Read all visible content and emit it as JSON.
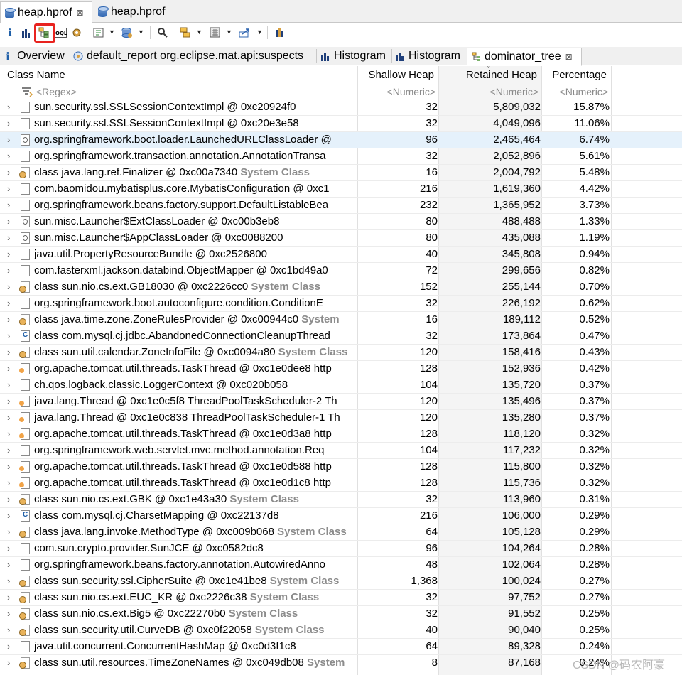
{
  "editor_tabs": [
    {
      "label": "heap.hprof",
      "close": "⊠"
    },
    {
      "label": "heap.hprof"
    }
  ],
  "toolbar": {
    "info": "i"
  },
  "result_tabs": [
    {
      "label": "Overview"
    },
    {
      "label": "default_report  org.eclipse.mat.api:suspects"
    },
    {
      "label": "Histogram"
    },
    {
      "label": "Histogram"
    },
    {
      "label": "dominator_tree",
      "close": "⊠"
    }
  ],
  "columns": {
    "class_name": "Class Name",
    "shallow": "Shallow Heap",
    "retained": "Retained Heap",
    "percentage": "Percentage"
  },
  "filters": {
    "class_name": "<Regex>",
    "shallow": "<Numeric>",
    "retained": "<Numeric>",
    "percentage": "<Numeric>"
  },
  "rows": [
    {
      "name": "sun.security.ssl.SSLSessionContextImpl @ 0xc20924f0",
      "sys": "",
      "shallow": "32",
      "retained": "5,809,032",
      "pct": "15.87%",
      "icon": "obj"
    },
    {
      "name": "sun.security.ssl.SSLSessionContextImpl @ 0xc20e3e58",
      "sys": "",
      "shallow": "32",
      "retained": "4,049,096",
      "pct": "11.06%",
      "icon": "obj"
    },
    {
      "name": "org.springframework.boot.loader.LaunchedURLClassLoader @",
      "sys": "",
      "shallow": "96",
      "retained": "2,465,464",
      "pct": "6.74%",
      "icon": "loader"
    },
    {
      "name": "org.springframework.transaction.annotation.AnnotationTransa",
      "sys": "",
      "shallow": "32",
      "retained": "2,052,896",
      "pct": "5.61%",
      "icon": "obj"
    },
    {
      "name": "class java.lang.ref.Finalizer @ 0xc00a7340 ",
      "sys": "System Class",
      "shallow": "16",
      "retained": "2,004,792",
      "pct": "5.48%",
      "icon": "cls"
    },
    {
      "name": "com.baomidou.mybatisplus.core.MybatisConfiguration @ 0xc1",
      "sys": "",
      "shallow": "216",
      "retained": "1,619,360",
      "pct": "4.42%",
      "icon": "obj"
    },
    {
      "name": "org.springframework.beans.factory.support.DefaultListableBea",
      "sys": "",
      "shallow": "232",
      "retained": "1,365,952",
      "pct": "3.73%",
      "icon": "obj"
    },
    {
      "name": "sun.misc.Launcher$ExtClassLoader @ 0xc00b3eb8",
      "sys": "",
      "shallow": "80",
      "retained": "488,488",
      "pct": "1.33%",
      "icon": "loader"
    },
    {
      "name": "sun.misc.Launcher$AppClassLoader @ 0xc0088200",
      "sys": "",
      "shallow": "80",
      "retained": "435,088",
      "pct": "1.19%",
      "icon": "loader"
    },
    {
      "name": "java.util.PropertyResourceBundle @ 0xc2526800",
      "sys": "",
      "shallow": "40",
      "retained": "345,808",
      "pct": "0.94%",
      "icon": "obj"
    },
    {
      "name": "com.fasterxml.jackson.databind.ObjectMapper @ 0xc1bd49a0",
      "sys": "",
      "shallow": "72",
      "retained": "299,656",
      "pct": "0.82%",
      "icon": "obj"
    },
    {
      "name": "class sun.nio.cs.ext.GB18030 @ 0xc2226cc0 ",
      "sys": "System Class",
      "shallow": "152",
      "retained": "255,144",
      "pct": "0.70%",
      "icon": "cls"
    },
    {
      "name": "org.springframework.boot.autoconfigure.condition.ConditionE",
      "sys": "",
      "shallow": "32",
      "retained": "226,192",
      "pct": "0.62%",
      "icon": "obj"
    },
    {
      "name": "class java.time.zone.ZoneRulesProvider @ 0xc00944c0 ",
      "sys": "System",
      "shallow": "16",
      "retained": "189,112",
      "pct": "0.52%",
      "icon": "cls"
    },
    {
      "name": "class com.mysql.cj.jdbc.AbandonedConnectionCleanupThread",
      "sys": "",
      "shallow": "32",
      "retained": "173,864",
      "pct": "0.47%",
      "icon": "cobj"
    },
    {
      "name": "class sun.util.calendar.ZoneInfoFile @ 0xc0094a80 ",
      "sys": "System Class",
      "shallow": "120",
      "retained": "158,416",
      "pct": "0.43%",
      "icon": "cls"
    },
    {
      "name": "org.apache.tomcat.util.threads.TaskThread @ 0xc1e0dee8  http",
      "sys": "",
      "shallow": "128",
      "retained": "152,936",
      "pct": "0.42%",
      "icon": "thread"
    },
    {
      "name": "ch.qos.logback.classic.LoggerContext @ 0xc020b058",
      "sys": "",
      "shallow": "104",
      "retained": "135,720",
      "pct": "0.37%",
      "icon": "obj"
    },
    {
      "name": "java.lang.Thread @ 0xc1e0c5f8  ThreadPoolTaskScheduler-2  Th",
      "sys": "",
      "shallow": "120",
      "retained": "135,496",
      "pct": "0.37%",
      "icon": "thread"
    },
    {
      "name": "java.lang.Thread @ 0xc1e0c838  ThreadPoolTaskScheduler-1  Th",
      "sys": "",
      "shallow": "120",
      "retained": "135,280",
      "pct": "0.37%",
      "icon": "thread"
    },
    {
      "name": "org.apache.tomcat.util.threads.TaskThread @ 0xc1e0d3a8  http",
      "sys": "",
      "shallow": "128",
      "retained": "118,120",
      "pct": "0.32%",
      "icon": "thread"
    },
    {
      "name": "org.springframework.web.servlet.mvc.method.annotation.Req",
      "sys": "",
      "shallow": "104",
      "retained": "117,232",
      "pct": "0.32%",
      "icon": "obj"
    },
    {
      "name": "org.apache.tomcat.util.threads.TaskThread @ 0xc1e0d588  http",
      "sys": "",
      "shallow": "128",
      "retained": "115,800",
      "pct": "0.32%",
      "icon": "thread"
    },
    {
      "name": "org.apache.tomcat.util.threads.TaskThread @ 0xc1e0d1c8  http",
      "sys": "",
      "shallow": "128",
      "retained": "115,736",
      "pct": "0.32%",
      "icon": "thread"
    },
    {
      "name": "class sun.nio.cs.ext.GBK @ 0xc1e43a30 ",
      "sys": "System Class",
      "shallow": "32",
      "retained": "113,960",
      "pct": "0.31%",
      "icon": "cls"
    },
    {
      "name": "class com.mysql.cj.CharsetMapping @ 0xc22137d8",
      "sys": "",
      "shallow": "216",
      "retained": "106,000",
      "pct": "0.29%",
      "icon": "cobj"
    },
    {
      "name": "class java.lang.invoke.MethodType @ 0xc009b068 ",
      "sys": "System Class",
      "shallow": "64",
      "retained": "105,128",
      "pct": "0.29%",
      "icon": "cls"
    },
    {
      "name": "com.sun.crypto.provider.SunJCE @ 0xc0582dc8",
      "sys": "",
      "shallow": "96",
      "retained": "104,264",
      "pct": "0.28%",
      "icon": "obj"
    },
    {
      "name": "org.springframework.beans.factory.annotation.AutowiredAnno",
      "sys": "",
      "shallow": "48",
      "retained": "102,064",
      "pct": "0.28%",
      "icon": "obj"
    },
    {
      "name": "class sun.security.ssl.CipherSuite @ 0xc1e41be8 ",
      "sys": "System Class",
      "shallow": "1,368",
      "retained": "100,024",
      "pct": "0.27%",
      "icon": "cls"
    },
    {
      "name": "class sun.nio.cs.ext.EUC_KR @ 0xc2226c38 ",
      "sys": "System Class",
      "shallow": "32",
      "retained": "97,752",
      "pct": "0.27%",
      "icon": "cls"
    },
    {
      "name": "class sun.nio.cs.ext.Big5 @ 0xc22270b0 ",
      "sys": "System Class",
      "shallow": "32",
      "retained": "91,552",
      "pct": "0.25%",
      "icon": "cls"
    },
    {
      "name": "class sun.security.util.CurveDB @ 0xc0f22058 ",
      "sys": "System Class",
      "shallow": "40",
      "retained": "90,040",
      "pct": "0.25%",
      "icon": "cls"
    },
    {
      "name": "java.util.concurrent.ConcurrentHashMap @ 0xc0d3f1c8",
      "sys": "",
      "shallow": "64",
      "retained": "89,328",
      "pct": "0.24%",
      "icon": "obj"
    },
    {
      "name": "class sun.util.resources.TimeZoneNames @ 0xc049db08 ",
      "sys": "System",
      "shallow": "8",
      "retained": "87,168",
      "pct": "0.24%",
      "icon": "cls"
    }
  ],
  "watermark": "CSDN @码农阿豪"
}
